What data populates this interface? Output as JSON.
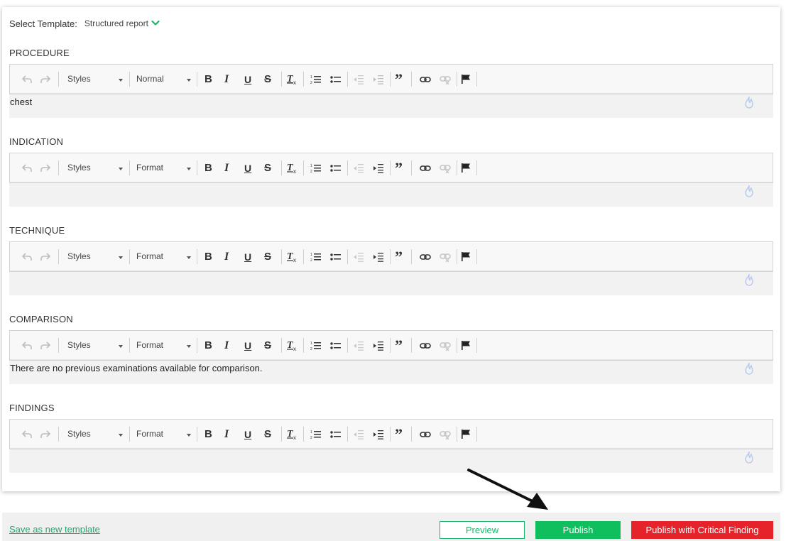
{
  "template_selector": {
    "label": "Select Template:",
    "value": "Structured report"
  },
  "toolbar": {
    "styles_label": "Styles",
    "format_label": "Format",
    "normal_label": "Normal"
  },
  "sections": [
    {
      "title": "PROCEDURE",
      "format_value": "Normal",
      "content": "chest"
    },
    {
      "title": "INDICATION",
      "format_value": "Format",
      "content": ""
    },
    {
      "title": "TECHNIQUE",
      "format_value": "Format",
      "content": ""
    },
    {
      "title": "COMPARISON",
      "format_value": "Format",
      "content": "There are no previous examinations available for comparison."
    },
    {
      "title": "FINDINGS",
      "format_value": "Format",
      "content": ""
    }
  ],
  "footer": {
    "save_template_link": "Save as new template",
    "preview_label": "Preview",
    "publish_label": "Publish",
    "critical_label": "Publish with Critical Finding"
  },
  "colors": {
    "accent_green": "#0fbf5e",
    "link_green": "#22a86a",
    "critical_red": "#e6232b"
  }
}
